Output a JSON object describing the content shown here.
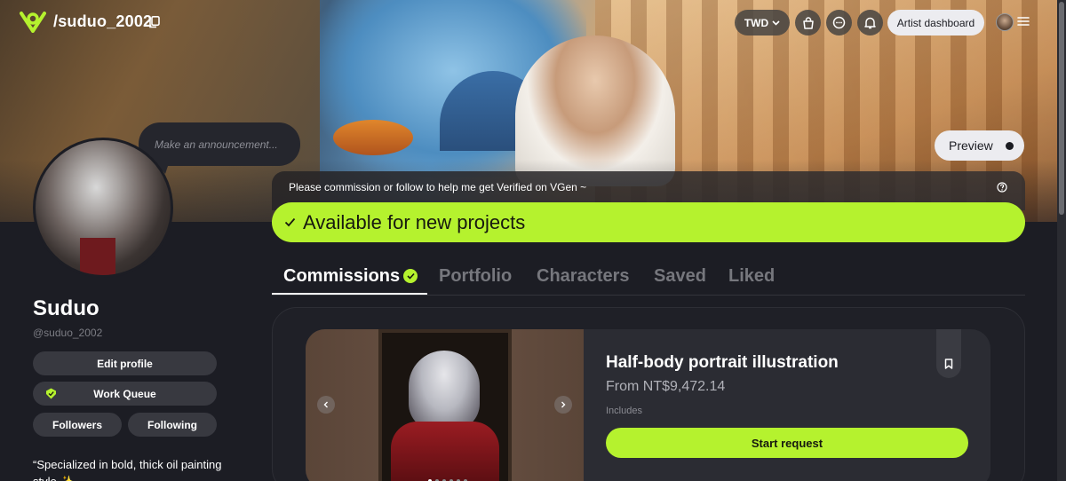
{
  "header": {
    "handle": "/suduo_2002",
    "currency": "TWD",
    "artist_dashboard": "Artist dashboard"
  },
  "announcement": {
    "placeholder": "Make an announcement..."
  },
  "preview": {
    "label": "Preview"
  },
  "notice": {
    "text": "Please commission or follow to help me get Verified on VGen ~"
  },
  "status": {
    "text": "Available for new projects"
  },
  "tabs": [
    {
      "label": "Commissions"
    },
    {
      "label": "Portfolio"
    },
    {
      "label": "Characters"
    },
    {
      "label": "Saved"
    },
    {
      "label": "Liked"
    }
  ],
  "profile": {
    "name": "Suduo",
    "username": "@suduo_2002",
    "edit_profile": "Edit profile",
    "work_queue": "Work Queue",
    "followers": "Followers",
    "following": "Following",
    "bio": "“Specialized in bold, thick oil painting style ✨"
  },
  "commission": {
    "title": "Half-body portrait illustration",
    "price": "From NT$9,472.14",
    "includes": "Includes",
    "start": "Start request",
    "gallery_count": 6,
    "gallery_active": 1
  },
  "colors": {
    "accent": "#b5f22e",
    "background": "#1c1d24"
  }
}
